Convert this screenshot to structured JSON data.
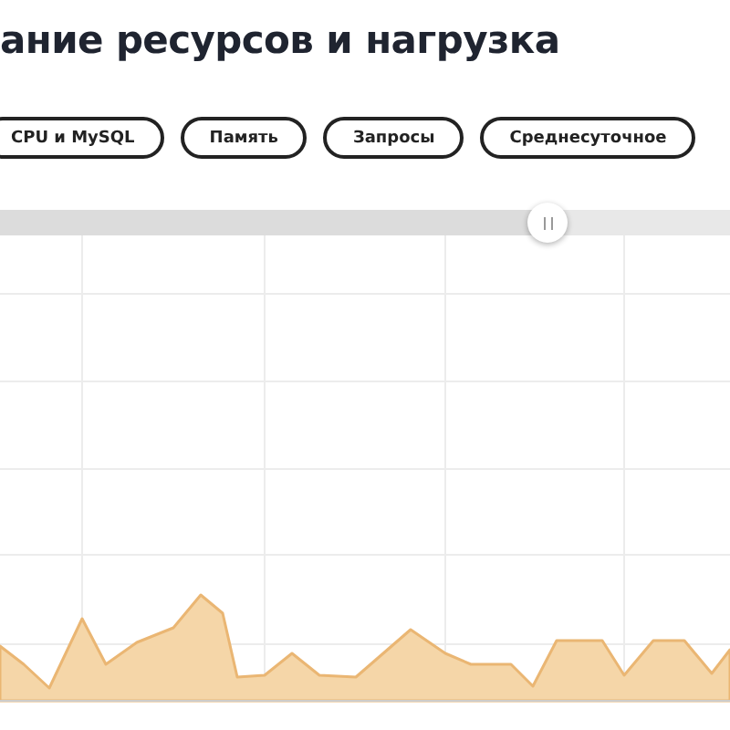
{
  "title": "ание ресурсов и нагрузка",
  "filters": [
    {
      "label": "CPU и MySQL"
    },
    {
      "label": "Память"
    },
    {
      "label": "Запросы"
    },
    {
      "label": "Среднесуточное"
    }
  ],
  "range_slider": {
    "level": 0.75
  }
}
